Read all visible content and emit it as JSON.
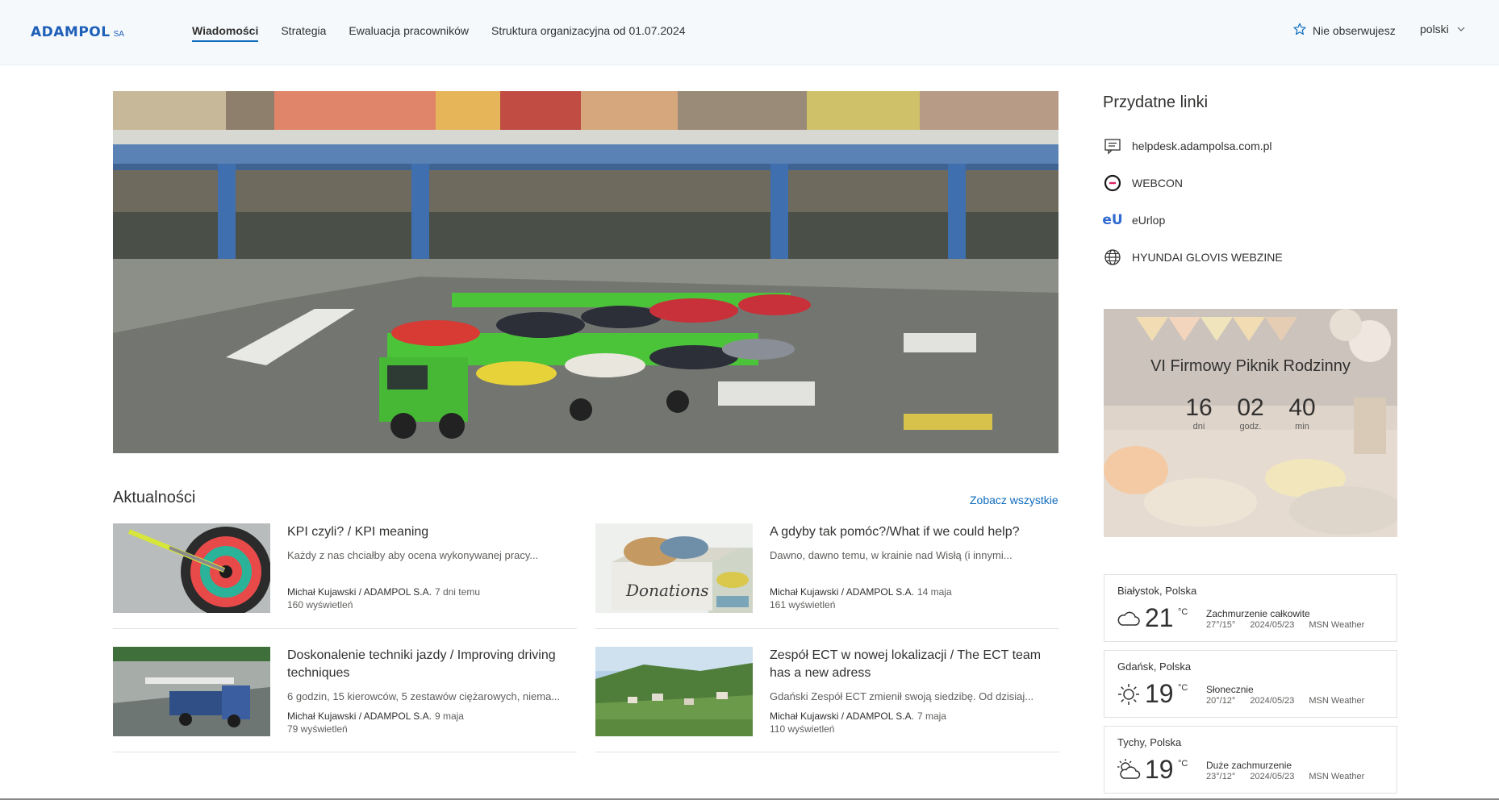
{
  "header": {
    "logo_text": "ADAMPOL",
    "logo_suffix": "SA",
    "nav": [
      {
        "label": "Wiadomości",
        "active": true
      },
      {
        "label": "Strategia",
        "active": false
      },
      {
        "label": "Ewaluacja pracowników",
        "active": false
      },
      {
        "label": "Struktura organizacyjna od 01.07.2024",
        "active": false
      }
    ],
    "follow_label": "Nie obserwujesz",
    "language": "polski"
  },
  "news": {
    "title": "Aktualności",
    "see_all": "Zobacz wszystkie",
    "items": [
      {
        "title": "KPI czyli? / KPI meaning",
        "excerpt": "Każdy z nas chciałby aby ocena wykonywanej pracy...",
        "author": "Michał Kujawski / ADAMPOL S.A.",
        "date": "7 dni temu",
        "views": "160 wyświetleń",
        "image": "dart-target"
      },
      {
        "title": "A gdyby tak pomóc?/What if we could help?",
        "excerpt": "Dawno, dawno temu,  w krainie nad Wisłą (i innymi...",
        "author": "Michał Kujawski / ADAMPOL S.A.",
        "date": "14 maja",
        "views": "161 wyświetleń",
        "image": "donations-box",
        "image_text": "Donations"
      },
      {
        "title": "Doskonalenie techniki jazdy / Improving driving techniques",
        "excerpt": "6 godzin, 15 kierowców, 5 zestawów ciężarowych, niema...",
        "author": "Michał Kujawski / ADAMPOL S.A.",
        "date": "9 maja",
        "views": "79 wyświetleń",
        "image": "truck-on-track"
      },
      {
        "title": "Zespół ECT w nowej lokalizacji / The ECT team has a new adress",
        "excerpt": "Gdański Zespół ECT zmienił swoją siedzibę. Od dzisiaj...",
        "author": "Michał Kujawski / ADAMPOL S.A.",
        "date": "7 maja",
        "views": "110 wyświetleń",
        "image": "green-town"
      }
    ]
  },
  "useful_links": {
    "title": "Przydatne linki",
    "items": [
      {
        "label": "helpdesk.adampolsa.com.pl",
        "icon": "chat-icon"
      },
      {
        "label": "WEBCON",
        "icon": "webcon-icon"
      },
      {
        "label": "eUrlop",
        "icon": "eu-icon",
        "icon_text": "eU"
      },
      {
        "label": "HYUNDAI GLOVIS WEBZINE",
        "icon": "globe-icon"
      }
    ]
  },
  "countdown": {
    "title": "VI Firmowy Piknik Rodzinny",
    "units": [
      {
        "value": "16",
        "label": "dni"
      },
      {
        "value": "02",
        "label": "godz."
      },
      {
        "value": "40",
        "label": "min"
      }
    ]
  },
  "weather": [
    {
      "city": "Białystok, Polska",
      "temp": "21",
      "unit": "°C",
      "condition": "Zachmurzenie całkowite",
      "range": "27°/15°",
      "date": "2024/05/23",
      "source": "MSN Weather",
      "icon": "cloud-icon"
    },
    {
      "city": "Gdańsk, Polska",
      "temp": "19",
      "unit": "°C",
      "condition": "Słonecznie",
      "range": "20°/12°",
      "date": "2024/05/23",
      "source": "MSN Weather",
      "icon": "sun-icon"
    },
    {
      "city": "Tychy, Polska",
      "temp": "19",
      "unit": "°C",
      "condition": "Duże zachmurzenie",
      "range": "23°/12°",
      "date": "2024/05/23",
      "source": "MSN Weather",
      "icon": "partly-cloudy-icon"
    }
  ],
  "colors": {
    "accent": "#0f6cbd",
    "brand": "#1e5fb8",
    "truck_green": "#4cc43a"
  }
}
